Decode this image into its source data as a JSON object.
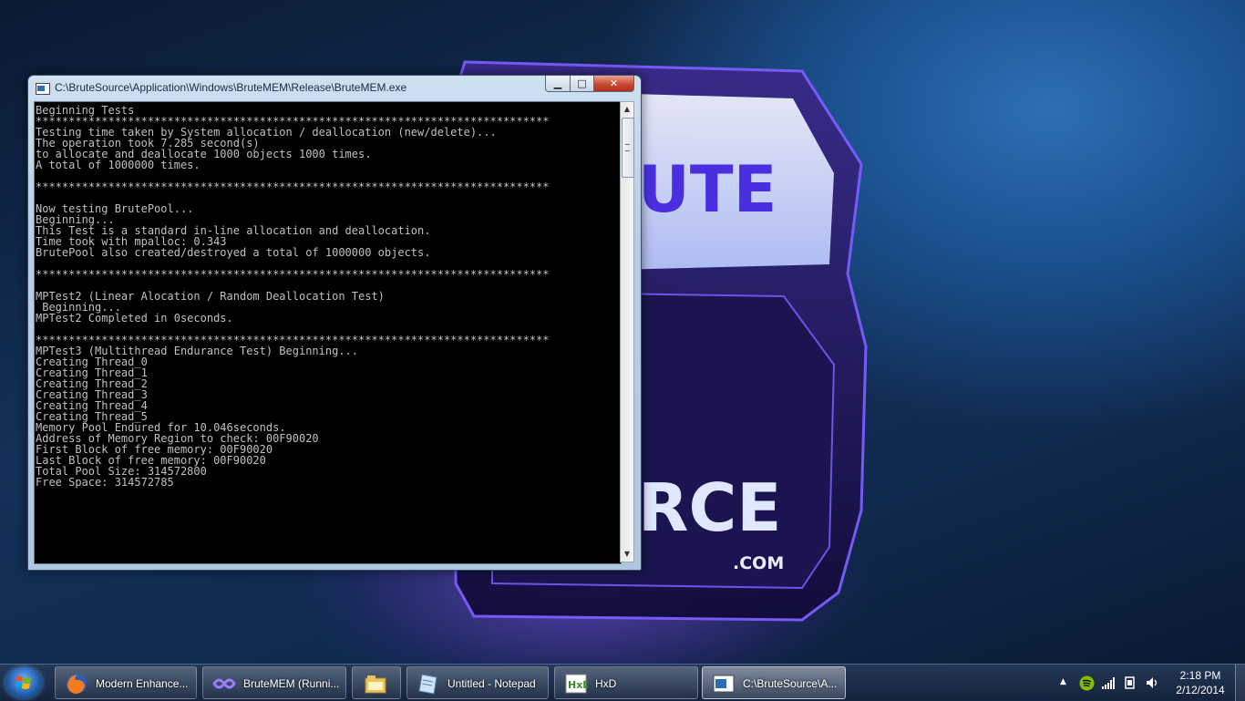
{
  "window": {
    "title": "C:\\BruteSource\\Application\\Windows\\BruteMEM\\Release\\BruteMEM.exe",
    "minimize_glyph": "▁",
    "maximize_glyph": "□",
    "close_glyph": "✕"
  },
  "console": {
    "lines": [
      "Beginning Tests",
      "******************************************************************************",
      "Testing time taken by System allocation / deallocation (new/delete)...",
      "The operation took 7.285 second(s)",
      "to allocate and deallocate 1000 objects 1000 times.",
      "A total of 1000000 times.",
      "",
      "******************************************************************************",
      "",
      "Now testing BrutePool...",
      "Beginning...",
      "This Test is a standard in-line allocation and deallocation.",
      "Time took with mpalloc: 0.343",
      "BrutePool also created/destroyed a total of 1000000 objects.",
      "",
      "******************************************************************************",
      "",
      "MPTest2 (Linear Alocation / Random Deallocation Test)",
      " Beginning...",
      "MPTest2 Completed in 0seconds.",
      "",
      "******************************************************************************",
      "MPTest3 (Multithread Endurance Test) Beginning...",
      "Creating Thread_0",
      "Creating Thread_1",
      "Creating Thread_2",
      "Creating Thread_3",
      "Creating Thread_4",
      "Creating Thread_5",
      "Memory Pool Endured for 10.046seconds.",
      "Address of Memory Region to check: 00F90020",
      "First Block of free memory: 00F90020",
      "Last Block of free memory: 00F90020",
      "Total Pool Size: 314572800",
      "Free Space: 314572785"
    ]
  },
  "wallpaper": {
    "logo_text_top": "UTE",
    "logo_text_bottom": "RCE",
    "logo_domain": ".COM"
  },
  "taskbar": {
    "items": [
      {
        "label": "Modern Enhance...",
        "icon": "firefox-icon"
      },
      {
        "label": "BruteMEM (Runni...",
        "icon": "visual-studio-icon"
      },
      {
        "label": "",
        "icon": "windows-explorer-icon"
      },
      {
        "label": "Untitled - Notepad",
        "icon": "notepad-icon"
      },
      {
        "label": "HxD",
        "icon": "hxd-icon"
      },
      {
        "label": "C:\\BruteSource\\A...",
        "icon": "console-icon"
      }
    ],
    "tray": {
      "expand_glyph": "▲",
      "time": "2:18 PM",
      "date": "2/12/2014"
    }
  },
  "colors": {
    "console_text": "#c0c0c0",
    "console_bg": "#000000",
    "accent_purple": "#6a3cff"
  }
}
